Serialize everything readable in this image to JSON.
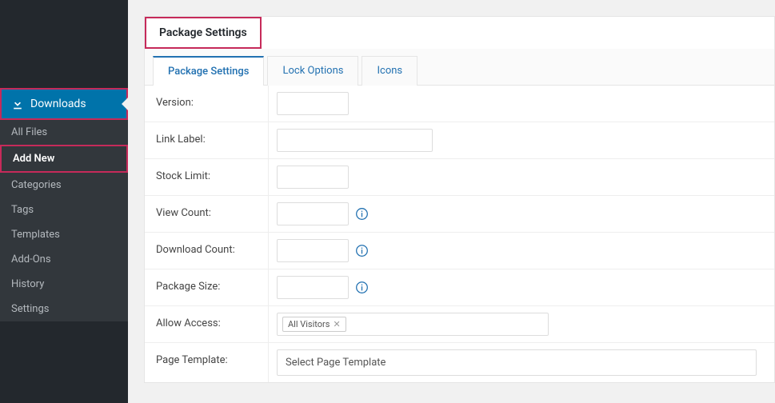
{
  "sidebar": {
    "main_label": "Downloads",
    "items": [
      {
        "label": "All Files"
      },
      {
        "label": "Add New"
      },
      {
        "label": "Categories"
      },
      {
        "label": "Tags"
      },
      {
        "label": "Templates"
      },
      {
        "label": "Add-Ons"
      },
      {
        "label": "History"
      },
      {
        "label": "Settings"
      }
    ]
  },
  "panel": {
    "title": "Package Settings"
  },
  "tabs": [
    {
      "label": "Package Settings"
    },
    {
      "label": "Lock Options"
    },
    {
      "label": "Icons"
    }
  ],
  "form": {
    "version_label": "Version:",
    "link_label_label": "Link Label:",
    "stock_limit_label": "Stock Limit:",
    "view_count_label": "View Count:",
    "download_count_label": "Download Count:",
    "package_size_label": "Package Size:",
    "allow_access_label": "Allow Access:",
    "allow_access_chip": "All Visitors",
    "page_template_label": "Page Template:",
    "page_template_placeholder": "Select Page Template"
  }
}
